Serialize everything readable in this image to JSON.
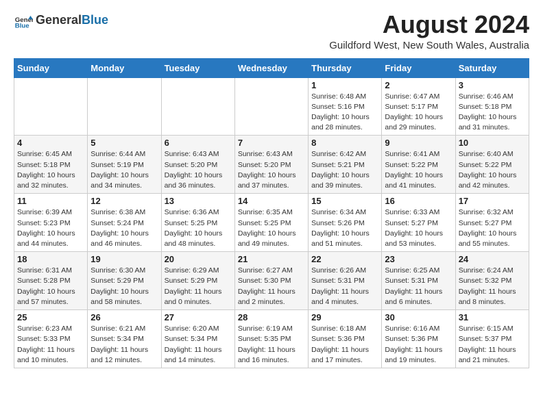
{
  "header": {
    "logo_general": "General",
    "logo_blue": "Blue",
    "month_year": "August 2024",
    "location": "Guildford West, New South Wales, Australia"
  },
  "weekdays": [
    "Sunday",
    "Monday",
    "Tuesday",
    "Wednesday",
    "Thursday",
    "Friday",
    "Saturday"
  ],
  "weeks": [
    [
      {
        "day": "",
        "info": ""
      },
      {
        "day": "",
        "info": ""
      },
      {
        "day": "",
        "info": ""
      },
      {
        "day": "",
        "info": ""
      },
      {
        "day": "1",
        "info": "Sunrise: 6:48 AM\nSunset: 5:16 PM\nDaylight: 10 hours\nand 28 minutes."
      },
      {
        "day": "2",
        "info": "Sunrise: 6:47 AM\nSunset: 5:17 PM\nDaylight: 10 hours\nand 29 minutes."
      },
      {
        "day": "3",
        "info": "Sunrise: 6:46 AM\nSunset: 5:18 PM\nDaylight: 10 hours\nand 31 minutes."
      }
    ],
    [
      {
        "day": "4",
        "info": "Sunrise: 6:45 AM\nSunset: 5:18 PM\nDaylight: 10 hours\nand 32 minutes."
      },
      {
        "day": "5",
        "info": "Sunrise: 6:44 AM\nSunset: 5:19 PM\nDaylight: 10 hours\nand 34 minutes."
      },
      {
        "day": "6",
        "info": "Sunrise: 6:43 AM\nSunset: 5:20 PM\nDaylight: 10 hours\nand 36 minutes."
      },
      {
        "day": "7",
        "info": "Sunrise: 6:43 AM\nSunset: 5:20 PM\nDaylight: 10 hours\nand 37 minutes."
      },
      {
        "day": "8",
        "info": "Sunrise: 6:42 AM\nSunset: 5:21 PM\nDaylight: 10 hours\nand 39 minutes."
      },
      {
        "day": "9",
        "info": "Sunrise: 6:41 AM\nSunset: 5:22 PM\nDaylight: 10 hours\nand 41 minutes."
      },
      {
        "day": "10",
        "info": "Sunrise: 6:40 AM\nSunset: 5:22 PM\nDaylight: 10 hours\nand 42 minutes."
      }
    ],
    [
      {
        "day": "11",
        "info": "Sunrise: 6:39 AM\nSunset: 5:23 PM\nDaylight: 10 hours\nand 44 minutes."
      },
      {
        "day": "12",
        "info": "Sunrise: 6:38 AM\nSunset: 5:24 PM\nDaylight: 10 hours\nand 46 minutes."
      },
      {
        "day": "13",
        "info": "Sunrise: 6:36 AM\nSunset: 5:25 PM\nDaylight: 10 hours\nand 48 minutes."
      },
      {
        "day": "14",
        "info": "Sunrise: 6:35 AM\nSunset: 5:25 PM\nDaylight: 10 hours\nand 49 minutes."
      },
      {
        "day": "15",
        "info": "Sunrise: 6:34 AM\nSunset: 5:26 PM\nDaylight: 10 hours\nand 51 minutes."
      },
      {
        "day": "16",
        "info": "Sunrise: 6:33 AM\nSunset: 5:27 PM\nDaylight: 10 hours\nand 53 minutes."
      },
      {
        "day": "17",
        "info": "Sunrise: 6:32 AM\nSunset: 5:27 PM\nDaylight: 10 hours\nand 55 minutes."
      }
    ],
    [
      {
        "day": "18",
        "info": "Sunrise: 6:31 AM\nSunset: 5:28 PM\nDaylight: 10 hours\nand 57 minutes."
      },
      {
        "day": "19",
        "info": "Sunrise: 6:30 AM\nSunset: 5:29 PM\nDaylight: 10 hours\nand 58 minutes."
      },
      {
        "day": "20",
        "info": "Sunrise: 6:29 AM\nSunset: 5:29 PM\nDaylight: 11 hours\nand 0 minutes."
      },
      {
        "day": "21",
        "info": "Sunrise: 6:27 AM\nSunset: 5:30 PM\nDaylight: 11 hours\nand 2 minutes."
      },
      {
        "day": "22",
        "info": "Sunrise: 6:26 AM\nSunset: 5:31 PM\nDaylight: 11 hours\nand 4 minutes."
      },
      {
        "day": "23",
        "info": "Sunrise: 6:25 AM\nSunset: 5:31 PM\nDaylight: 11 hours\nand 6 minutes."
      },
      {
        "day": "24",
        "info": "Sunrise: 6:24 AM\nSunset: 5:32 PM\nDaylight: 11 hours\nand 8 minutes."
      }
    ],
    [
      {
        "day": "25",
        "info": "Sunrise: 6:23 AM\nSunset: 5:33 PM\nDaylight: 11 hours\nand 10 minutes."
      },
      {
        "day": "26",
        "info": "Sunrise: 6:21 AM\nSunset: 5:34 PM\nDaylight: 11 hours\nand 12 minutes."
      },
      {
        "day": "27",
        "info": "Sunrise: 6:20 AM\nSunset: 5:34 PM\nDaylight: 11 hours\nand 14 minutes."
      },
      {
        "day": "28",
        "info": "Sunrise: 6:19 AM\nSunset: 5:35 PM\nDaylight: 11 hours\nand 16 minutes."
      },
      {
        "day": "29",
        "info": "Sunrise: 6:18 AM\nSunset: 5:36 PM\nDaylight: 11 hours\nand 17 minutes."
      },
      {
        "day": "30",
        "info": "Sunrise: 6:16 AM\nSunset: 5:36 PM\nDaylight: 11 hours\nand 19 minutes."
      },
      {
        "day": "31",
        "info": "Sunrise: 6:15 AM\nSunset: 5:37 PM\nDaylight: 11 hours\nand 21 minutes."
      }
    ]
  ]
}
